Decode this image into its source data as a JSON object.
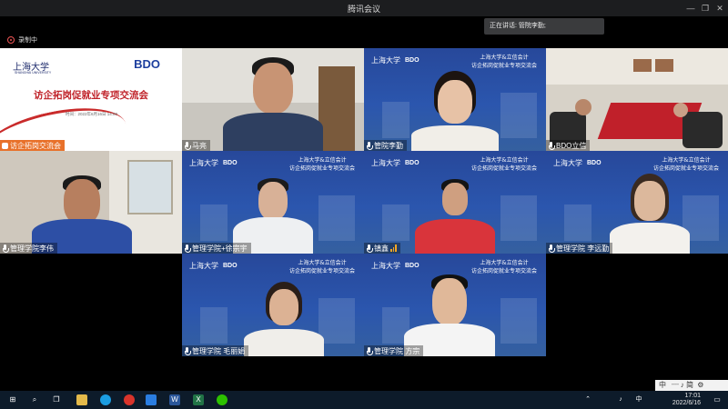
{
  "window": {
    "title": "腾讯会议"
  },
  "recording": {
    "label": "录制中"
  },
  "speaking": {
    "label": "正在讲话: 管院李勤;"
  },
  "background_text": {
    "university": "上海大学",
    "bdo": "BDO",
    "banner_line1": "上海大学&立信会计",
    "banner_line2": "访企拓岗促就业专项交流会"
  },
  "slide": {
    "university_logo": "上海大学",
    "university_en": "SHANGHAI UNIVERSITY",
    "bdo_logo": "BDO",
    "title": "访企拓岗促就业专项交流会",
    "date": "时间：2022年6月16日 14:00"
  },
  "participants": [
    {
      "name": "访企拓岗交流会"
    },
    {
      "name": "马亮"
    },
    {
      "name": "管院李勤"
    },
    {
      "name": "BDO立信"
    },
    {
      "name": "管理学院李伟"
    },
    {
      "name": "管理学院+徐宗宇"
    },
    {
      "name": "镇鑫"
    },
    {
      "name": "管理学院 李远勤"
    },
    {
      "name": "管理学院 毛丽娟"
    },
    {
      "name": "管理学院 方宗"
    }
  ],
  "taskbar": {
    "time": "17:01",
    "date": "2022/6/16",
    "ime": "中 ᠁ ♪ 简 ⚙"
  },
  "colors": {
    "accent": "#f5a623",
    "slide_title": "#c0232a",
    "blue_bg": "#2b56ae"
  }
}
